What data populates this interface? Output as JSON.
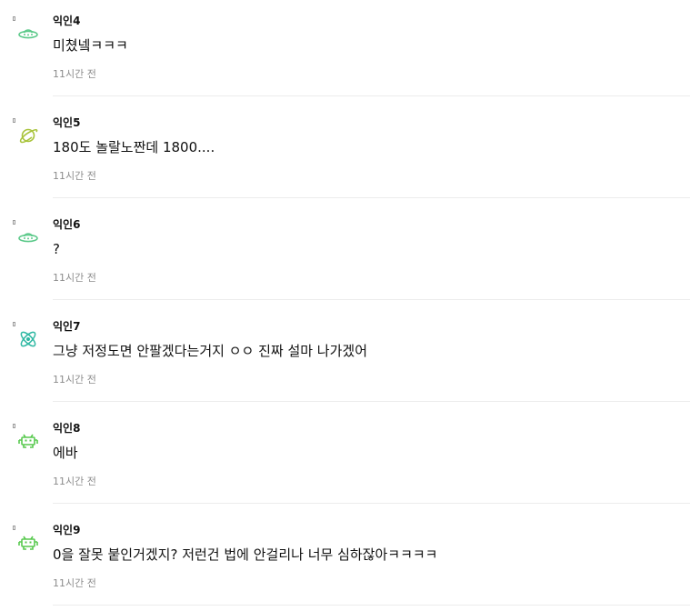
{
  "comments": [
    {
      "author": "익인4",
      "text": "미쳤넼ㅋㅋㅋ",
      "time": "11시간 전",
      "avatar_icon": "ufo-icon",
      "avatar_color": "#5cc98a"
    },
    {
      "author": "익인5",
      "text": "180도 놀랄노짠데 1800....",
      "time": "11시간 전",
      "avatar_icon": "planet-icon",
      "avatar_color": "#a8c33a"
    },
    {
      "author": "익인6",
      "text": "?",
      "time": "11시간 전",
      "avatar_icon": "ufo-icon",
      "avatar_color": "#5cc98a"
    },
    {
      "author": "익인7",
      "text": "그냥 저정도면 안팔겠다는거지 ㅇㅇ 진짜 설마 나가겠어",
      "time": "11시간 전",
      "avatar_icon": "atom-icon",
      "avatar_color": "#2fb8a3"
    },
    {
      "author": "익인8",
      "text": "에바",
      "time": "11시간 전",
      "avatar_icon": "space-invader-icon",
      "avatar_color": "#58c94f"
    },
    {
      "author": "익인9",
      "text": "0을 잘못 붙인거겠지? 저런건 법에 안걸리나 너무 심하잖아ㅋㅋㅋㅋ",
      "time": "11시간 전",
      "avatar_icon": "space-invader-icon",
      "avatar_color": "#58c94f"
    }
  ]
}
